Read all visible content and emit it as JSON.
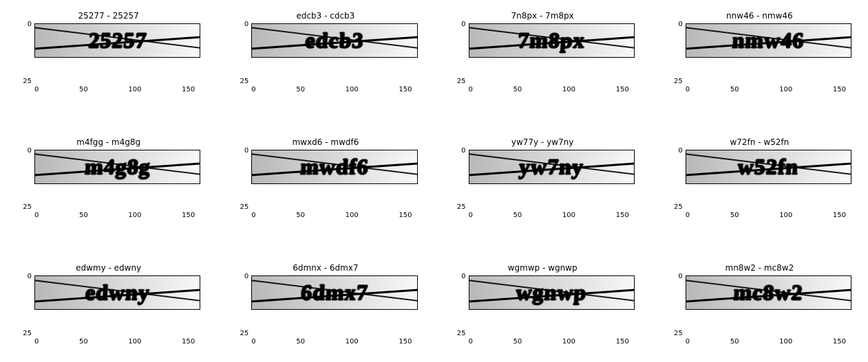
{
  "chart_data": [
    {
      "type": "image",
      "title": "25277 - 25257",
      "captcha": "25257",
      "xticks": [
        0,
        50,
        100,
        150
      ],
      "yticks": [
        0,
        25
      ],
      "xlim": [
        0,
        180
      ],
      "ylim": [
        0,
        50
      ]
    },
    {
      "type": "image",
      "title": "edcb3 - cdcb3",
      "captcha": "edcb3",
      "xticks": [
        0,
        50,
        100,
        150
      ],
      "yticks": [
        0,
        25
      ],
      "xlim": [
        0,
        180
      ],
      "ylim": [
        0,
        50
      ]
    },
    {
      "type": "image",
      "title": "7n8px - 7m8px",
      "captcha": "7m8px",
      "xticks": [
        0,
        50,
        100,
        150
      ],
      "yticks": [
        0,
        25
      ],
      "xlim": [
        0,
        180
      ],
      "ylim": [
        0,
        50
      ]
    },
    {
      "type": "image",
      "title": "nnw46 - nmw46",
      "captcha": "nmw46",
      "xticks": [
        0,
        50,
        100,
        150
      ],
      "yticks": [
        0,
        25
      ],
      "xlim": [
        0,
        180
      ],
      "ylim": [
        0,
        50
      ]
    },
    {
      "type": "image",
      "title": "m4fgg - m4g8g",
      "captcha": "m4g8g",
      "xticks": [
        0,
        50,
        100,
        150
      ],
      "yticks": [
        0,
        25
      ],
      "xlim": [
        0,
        180
      ],
      "ylim": [
        0,
        50
      ]
    },
    {
      "type": "image",
      "title": "mwxd6 - mwdf6",
      "captcha": "mwdf6",
      "xticks": [
        0,
        50,
        100,
        150
      ],
      "yticks": [
        0,
        25
      ],
      "xlim": [
        0,
        180
      ],
      "ylim": [
        0,
        50
      ]
    },
    {
      "type": "image",
      "title": "yw77y - yw7ny",
      "captcha": "yw7ny",
      "xticks": [
        0,
        50,
        100,
        150
      ],
      "yticks": [
        0,
        25
      ],
      "xlim": [
        0,
        180
      ],
      "ylim": [
        0,
        50
      ]
    },
    {
      "type": "image",
      "title": "w72fn - w52fn",
      "captcha": "w52fn",
      "xticks": [
        0,
        50,
        100,
        150
      ],
      "yticks": [
        0,
        25
      ],
      "xlim": [
        0,
        180
      ],
      "ylim": [
        0,
        50
      ]
    },
    {
      "type": "image",
      "title": "edwmy - edwny",
      "captcha": "edwny",
      "xticks": [
        0,
        50,
        100,
        150
      ],
      "yticks": [
        0,
        25
      ],
      "xlim": [
        0,
        180
      ],
      "ylim": [
        0,
        50
      ]
    },
    {
      "type": "image",
      "title": "6dmnx - 6dmx7",
      "captcha": "6dmx7",
      "xticks": [
        0,
        50,
        100,
        150
      ],
      "yticks": [
        0,
        25
      ],
      "xlim": [
        0,
        180
      ],
      "ylim": [
        0,
        50
      ]
    },
    {
      "type": "image",
      "title": "wgmwp - wgnwp",
      "captcha": "wgnwp",
      "xticks": [
        0,
        50,
        100,
        150
      ],
      "yticks": [
        0,
        25
      ],
      "xlim": [
        0,
        180
      ],
      "ylim": [
        0,
        50
      ]
    },
    {
      "type": "image",
      "title": "mn8w2 - mc8w2",
      "captcha": "mc8w2",
      "xticks": [
        0,
        50,
        100,
        150
      ],
      "yticks": [
        0,
        25
      ],
      "xlim": [
        0,
        180
      ],
      "ylim": [
        0,
        50
      ]
    }
  ]
}
